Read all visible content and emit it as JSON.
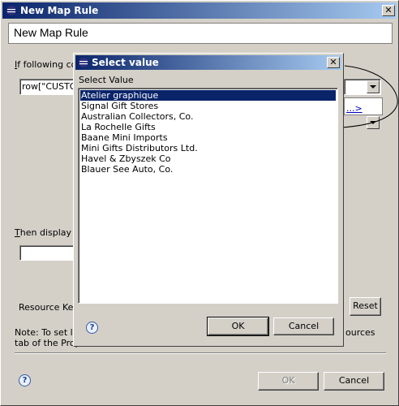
{
  "window": {
    "title": "New Map Rule"
  },
  "header": {
    "title": "New Map Rule"
  },
  "condition": {
    "label_prefix": "I",
    "label_rest": "f following cor",
    "expression_value": "row[\"CUSTOM"
  },
  "link": {
    "text": "...>"
  },
  "display": {
    "label_prefix": "T",
    "label_rest": "hen display fo",
    "value": ""
  },
  "resource_key": {
    "label": "Resource Key",
    "reset_label": "Reset"
  },
  "note": {
    "line1_left": "Note: To set lo",
    "line1_right": "ources",
    "line2": "tab of the Prop"
  },
  "footer": {
    "ok_label": "OK",
    "cancel_label": "Cancel",
    "help": "?"
  },
  "dialog": {
    "title": "Select value",
    "list_label": "Select Value",
    "items": [
      "Atelier graphique",
      "Signal Gift Stores",
      "Australian Collectors, Co.",
      "La Rochelle Gifts",
      "Baane Mini Imports",
      "Mini Gifts Distributors Ltd.",
      "Havel & Zbyszek Co",
      "Blauer See Auto, Co."
    ],
    "selected_index": 0,
    "ok_label": "OK",
    "cancel_label": "Cancel",
    "help": "?"
  },
  "colors": {
    "titlebar_start": "#0a246a",
    "titlebar_end": "#a6caf0",
    "selection": "#0a246a"
  }
}
